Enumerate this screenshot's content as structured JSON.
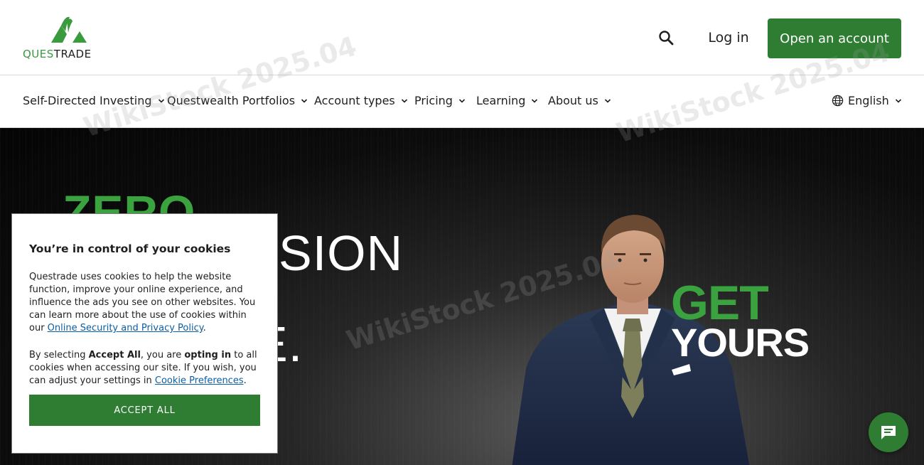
{
  "header": {
    "logo_text_left": "QUES",
    "logo_text_right": "TRADE",
    "login_label": "Log in",
    "open_account_label": "Open an account",
    "search_icon": "search-icon"
  },
  "nav": {
    "items": [
      {
        "label": "Self-Directed Investing"
      },
      {
        "label": "Questwealth Portfolios"
      },
      {
        "label": "Account types"
      },
      {
        "label": "Pricing"
      },
      {
        "label": "Learning"
      },
      {
        "label": "About us"
      }
    ],
    "language": "English"
  },
  "hero": {
    "line1": "ZERO",
    "line2": "SION",
    "line3": "E.",
    "get": "GET",
    "yours": "YOURS"
  },
  "watermark": {
    "text": "WikiStock 2025.04"
  },
  "cookie": {
    "title": "You’re in control of your cookies",
    "para1_text": "Questrade uses cookies to help the website function, improve your online experience, and influence the ads you see on other websites. You can learn more about the use of cookies within our ",
    "para1_link": "Online Security and Privacy Policy",
    "para1_end": ".",
    "para2_a": "By selecting ",
    "para2_b": "Accept All",
    "para2_c": ", you are ",
    "para2_d": "opting in",
    "para2_e": " to all cookies when accessing our site. If you wish, you can adjust your settings in ",
    "para2_link": "Cookie Preferences",
    "para2_end": ".",
    "accept_label": "ACCEPT ALL"
  },
  "colors": {
    "brand_green": "#2e7d32",
    "hero_green": "#3aa33f",
    "link_blue": "#0b5fa5"
  }
}
